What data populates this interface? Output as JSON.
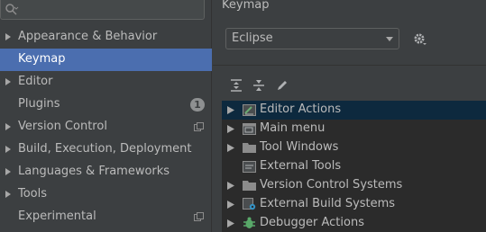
{
  "settings_tree": {
    "items": [
      {
        "label": "Appearance & Behavior",
        "expandable": true
      },
      {
        "label": "Keymap",
        "selected": true
      },
      {
        "label": "Editor",
        "expandable": true
      },
      {
        "label": "Plugins",
        "badge": "1"
      },
      {
        "label": "Version Control",
        "expandable": true,
        "project_icon": true
      },
      {
        "label": "Build, Execution, Deployment",
        "expandable": true
      },
      {
        "label": "Languages & Frameworks",
        "expandable": true
      },
      {
        "label": "Tools",
        "expandable": true
      },
      {
        "label": "Experimental",
        "project_icon": true
      }
    ]
  },
  "keymap": {
    "title": "Keymap",
    "scheme_value": "Eclipse",
    "toolbar": [
      "expand-all-icon",
      "collapse-all-icon",
      "edit-icon"
    ],
    "actions": [
      {
        "label": "Editor Actions",
        "icon": "editor-actions-icon",
        "expandable": true,
        "selected": true
      },
      {
        "label": "Main menu",
        "icon": "main-menu-icon",
        "expandable": true
      },
      {
        "label": "Tool Windows",
        "icon": "folder-icon",
        "expandable": true
      },
      {
        "label": "External Tools",
        "icon": "external-tools-icon",
        "expandable": false
      },
      {
        "label": "Version Control Systems",
        "icon": "folder-icon",
        "expandable": true
      },
      {
        "label": "External Build Systems",
        "icon": "build-systems-icon",
        "expandable": true
      },
      {
        "label": "Debugger Actions",
        "icon": "debugger-icon",
        "expandable": true
      }
    ]
  },
  "colors": {
    "background": "#3c3f41",
    "selection": "#4b6eaf",
    "list_background": "#2b2b2b",
    "list_selection": "#0d293e",
    "text": "#bbbbbb"
  }
}
